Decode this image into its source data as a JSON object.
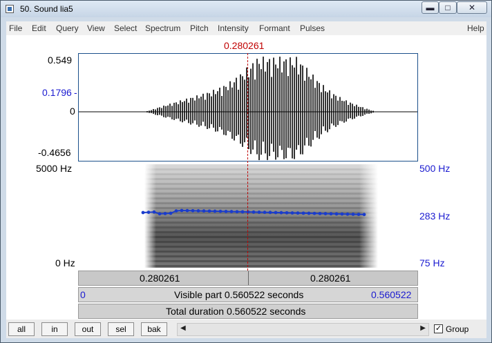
{
  "window": {
    "title": "50. Sound lia5",
    "min_icon": "minimize-icon",
    "max_icon": "maximize-icon",
    "close_icon": "close-icon"
  },
  "menu": [
    "File",
    "Edit",
    "Query",
    "View",
    "Select",
    "Spectrum",
    "Pitch",
    "Intensity",
    "Formant",
    "Pulses"
  ],
  "help": "Help",
  "cursor": {
    "time": "0.280261"
  },
  "waveform": {
    "max": "0.549",
    "value": "0.1796",
    "zero": "0",
    "min": "-0.4656"
  },
  "spectrogram": {
    "freq_max": "5000 Hz",
    "freq_min": "0 Hz"
  },
  "pitch_axis": {
    "top": "500 Hz",
    "mid": "283 Hz",
    "bottom": "75 Hz"
  },
  "time_bar": {
    "left": "0.280261",
    "right": "0.280261",
    "visible_start": "0",
    "visible_text": "Visible part 0.560522 seconds",
    "visible_end": "0.560522",
    "total_text": "Total duration 0.560522 seconds"
  },
  "bottom": {
    "buttons": [
      "all",
      "in",
      "out",
      "sel",
      "bak"
    ],
    "group_label": "Group",
    "group_checked": true
  },
  "colors": {
    "waveform": "#000000",
    "pitch": "#1a3ccc",
    "cursor": "#c00000",
    "frame": "#1a4f8a"
  }
}
